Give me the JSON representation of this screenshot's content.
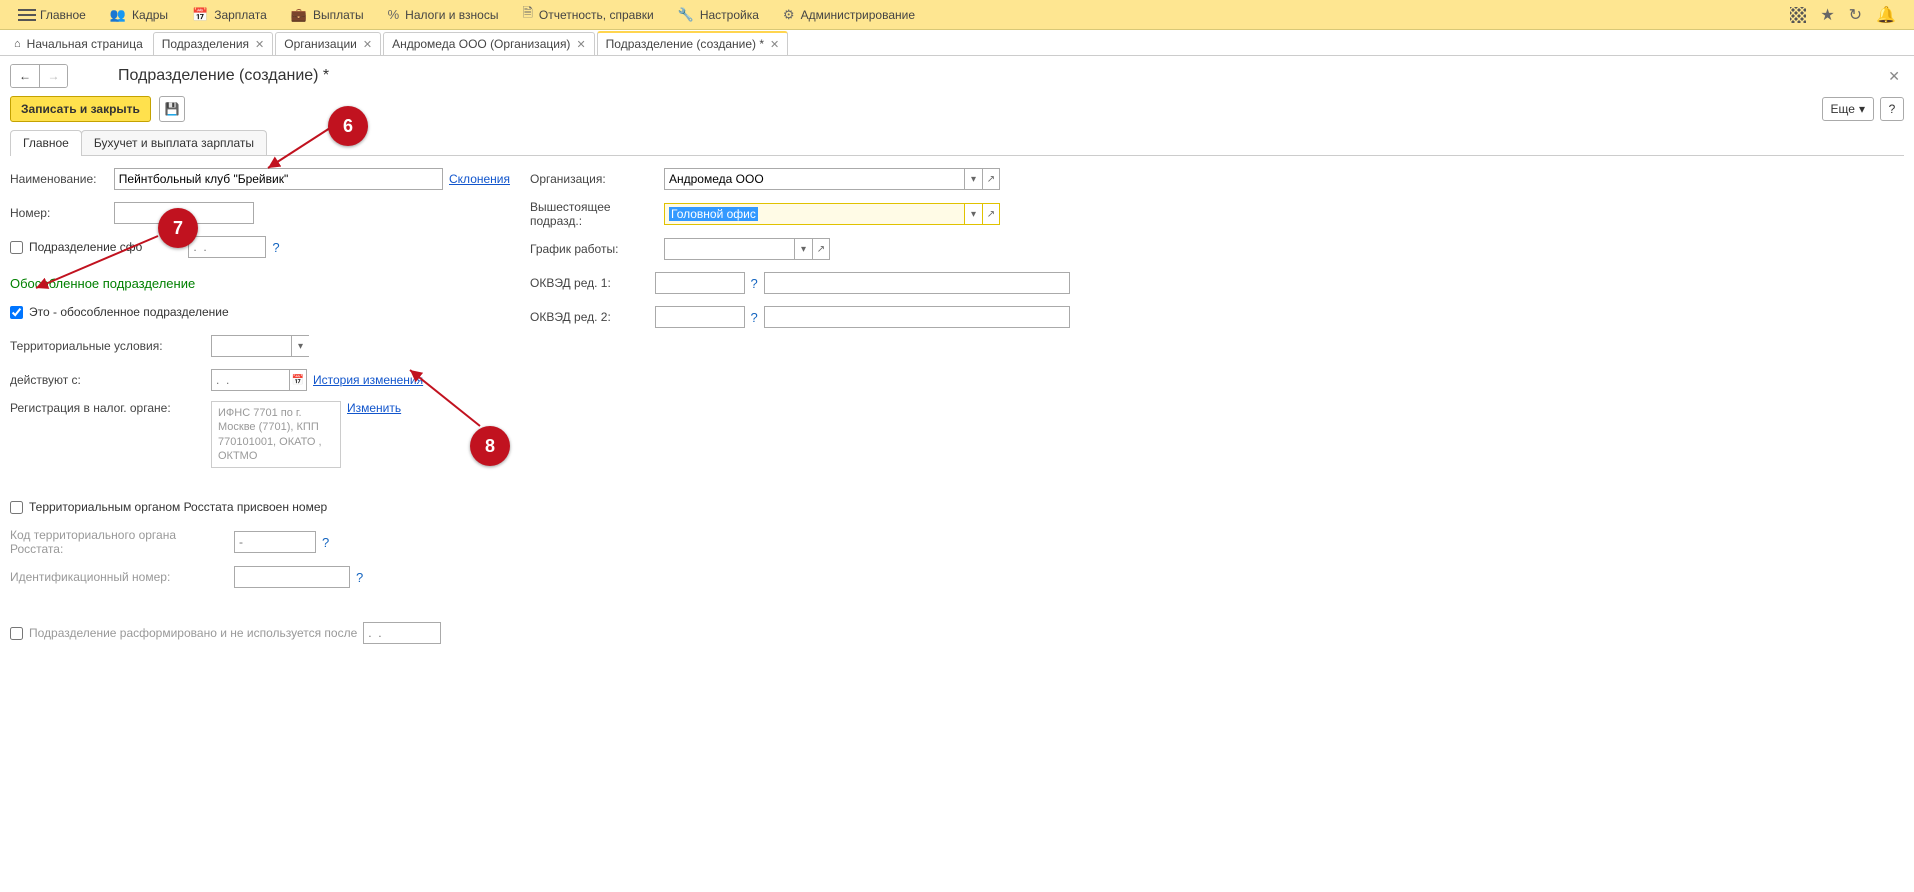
{
  "menu": {
    "items": [
      {
        "label": "Главное"
      },
      {
        "label": "Кадры"
      },
      {
        "label": "Зарплата"
      },
      {
        "label": "Выплаты"
      },
      {
        "label": "Налоги и взносы"
      },
      {
        "label": "Отчетность, справки"
      },
      {
        "label": "Настройка"
      },
      {
        "label": "Администрирование"
      }
    ]
  },
  "tabs": [
    {
      "label": "Начальная страница",
      "closable": false,
      "home": true
    },
    {
      "label": "Подразделения",
      "closable": true
    },
    {
      "label": "Организации",
      "closable": true
    },
    {
      "label": "Андромеда ООО (Организация)",
      "closable": true
    },
    {
      "label": "Подразделение (создание) *",
      "closable": true,
      "active": true
    }
  ],
  "page": {
    "title": "Подразделение (создание) *",
    "save_close": "Записать и закрыть",
    "more": "Еще",
    "help_tip": "?"
  },
  "formtabs": {
    "main": "Главное",
    "accounting": "Бухучет и выплата зарплаты"
  },
  "form": {
    "name_label": "Наименование:",
    "name_value": "Пейнтбольный клуб \"Брейвик\"",
    "declensions": "Склонения",
    "number_label": "Номер:",
    "number_value": "",
    "formed_label": "Подразделение сфо",
    "formed_placeholder": ".  .",
    "org_label": "Организация:",
    "org_value": "Андромеда ООО",
    "parent_label": "Вышестоящее подразд.:",
    "parent_value": "Головной офис",
    "schedule_label": "График работы:",
    "okved1_label": "ОКВЭД ред. 1:",
    "okved2_label": "ОКВЭД ред. 2:",
    "sep_section": "Обособленное подразделение",
    "sep_check": "Это - обособленное подразделение",
    "terr_label": "Территориальные условия:",
    "valid_from_label": "действуют с:",
    "valid_from_placeholder": ".  .",
    "history_link": "История изменения",
    "reg_label": "Регистрация в налог. органе:",
    "reg_text": "ИФНС 7701 по г. Москве (7701), КПП 770101001, ОКАТО , ОКТМО",
    "change_link": "Изменить",
    "rosstat_check": "Территориальным органом Росстата присвоен номер",
    "rosstat_code_label": "Код территориального органа Росстата:",
    "rosstat_code_placeholder": "-",
    "ident_label": "Идентификационный номер:",
    "disband_label": "Подразделение расформировано и не используется после",
    "disband_placeholder": ".  ."
  },
  "callouts": {
    "c6": "6",
    "c7": "7",
    "c8": "8"
  }
}
